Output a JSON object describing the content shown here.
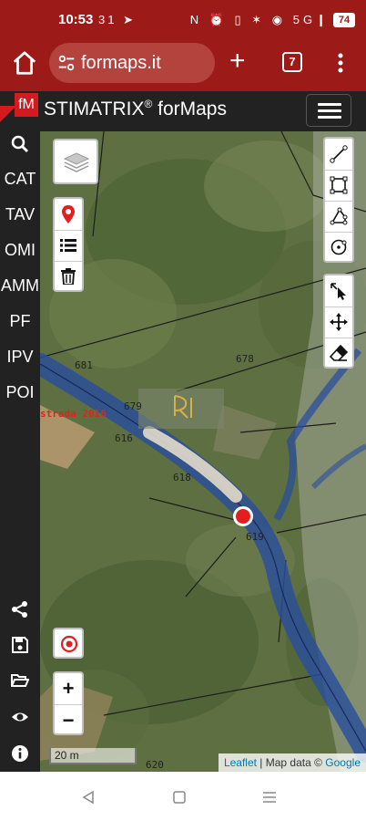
{
  "status": {
    "time": "10:53",
    "left_icons": "31 ➤",
    "right_icons": "N ⏰ ▯ ✶ ◉ 5G❙",
    "battery": "74"
  },
  "browser": {
    "url": "formaps.it",
    "tab_count": "7",
    "colors": {
      "toolbar": "#9c1a17",
      "url_field": "#b4423d"
    }
  },
  "app": {
    "logo_text": "fM",
    "title": "STIMATRIX",
    "title_mark": "®",
    "title_suffix": " forMaps"
  },
  "sidebar": {
    "items": [
      {
        "label": "CAT"
      },
      {
        "label": "TAV"
      },
      {
        "label": "OMI"
      },
      {
        "label": "AMM"
      },
      {
        "label": "PF"
      },
      {
        "label": "IPV"
      },
      {
        "label": "POI"
      }
    ],
    "icons": [
      "search-icon",
      "share-icon",
      "save-icon",
      "folder-open-icon",
      "eye-icon",
      "info-icon"
    ]
  },
  "map": {
    "parcel_labels": [
      "681",
      "678",
      "679",
      "616",
      "618",
      "619",
      "620"
    ],
    "road_label": "strada 2016",
    "scale": "20 m",
    "attribution": {
      "leaflet": "Leaflet",
      "sep": " | Map data © ",
      "provider": "Google"
    },
    "zoom_in": "+",
    "zoom_out": "−",
    "colors": {
      "marker": "#e41e1e",
      "road": "#2a4e9c"
    }
  }
}
